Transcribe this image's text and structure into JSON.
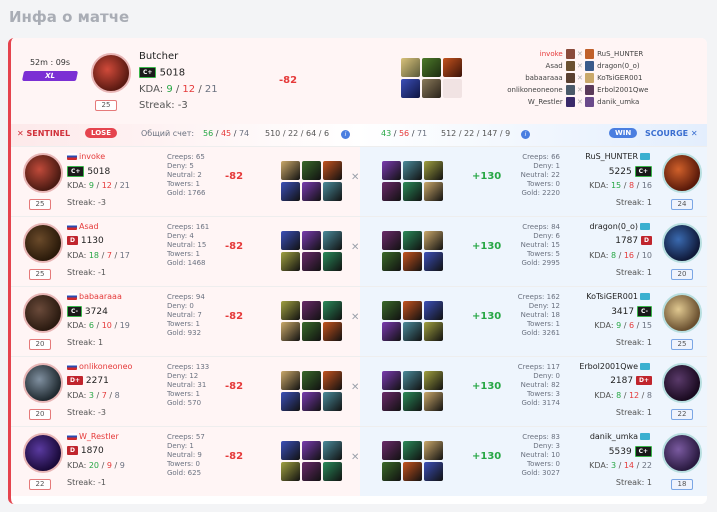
{
  "title": "Инфа о матче",
  "summary": {
    "duration": "52m : 09s",
    "size": "XL",
    "hero_level": "25",
    "name": "Butcher",
    "rank": "C+",
    "rating": "5018",
    "kda_label": "KDA:",
    "kda": [
      "9",
      "12",
      "21"
    ],
    "streak": "Streak: -3",
    "rating_change": "-82",
    "matchups": [
      {
        "left": "invoke",
        "right": "RuS_HUNTER"
      },
      {
        "left": "Asad",
        "right": "dragon(0_o)"
      },
      {
        "left": "babaaraaa",
        "right": "KoTsiGER001"
      },
      {
        "left": "onlikoneoneone",
        "right": "Erbol2001Qwe"
      },
      {
        "left": "W_Restler",
        "right": "danik_umka"
      }
    ]
  },
  "teambar": {
    "sentinel": "SENTINEL",
    "lose": "LOSE",
    "total_label": "Общий счет:",
    "left_kda": [
      "56",
      "45",
      "74"
    ],
    "left_extra": "510 / 22 / 64 / 6",
    "right_kda": [
      "43",
      "56",
      "71"
    ],
    "right_extra": "512 / 22 / 147 / 9",
    "win": "WIN",
    "scourge": "SCOURGE"
  },
  "rows": [
    {
      "l": {
        "name": "invoke",
        "rank": "C+",
        "rank_class": "cplus",
        "rating": "5018",
        "kda": [
          "9",
          "12",
          "21"
        ],
        "streak": "Streak: -3",
        "level": "25",
        "creeps": "Creeps: 65",
        "deny": "Deny: 5",
        "neutral": "Neutral: 2",
        "towers": "Towers: 1",
        "gold": "Gold: 1766",
        "change": "-82"
      },
      "r": {
        "name": "RuS_HUNTER",
        "rank": "C+",
        "rank_class": "cplus",
        "rating": "5225",
        "kda": [
          "15",
          "8",
          "16"
        ],
        "streak": "Streak: 1",
        "level": "24",
        "creeps": "Creeps: 66",
        "deny": "Deny: 1",
        "neutral": "Neutral: 22",
        "towers": "Towers: 0",
        "gold": "Gold: 2220",
        "change": "+130"
      }
    },
    {
      "l": {
        "name": "Asad",
        "rank": "D",
        "rank_class": "dminus",
        "rating": "1130",
        "kda": [
          "18",
          "7",
          "17"
        ],
        "streak": "Streak: -1",
        "level": "25",
        "creeps": "Creeps: 161",
        "deny": "Deny: 4",
        "neutral": "Neutral: 15",
        "towers": "Towers: 1",
        "gold": "Gold: 1468",
        "change": "-82"
      },
      "r": {
        "name": "dragon(0_o)",
        "rank": "D",
        "rank_class": "dminus",
        "rating": "1787",
        "kda": [
          "8",
          "16",
          "10"
        ],
        "streak": "Streak: 1",
        "level": "20",
        "creeps": "Creeps: 84",
        "deny": "Deny: 6",
        "neutral": "Neutral: 15",
        "towers": "Towers: 5",
        "gold": "Gold: 2995",
        "change": "+130"
      }
    },
    {
      "l": {
        "name": "babaaraaa",
        "rank": "C-",
        "rank_class": "cplus",
        "rating": "3724",
        "kda": [
          "6",
          "10",
          "19"
        ],
        "streak": "Streak: 1",
        "level": "20",
        "creeps": "Creeps: 94",
        "deny": "Deny: 0",
        "neutral": "Neutral: 7",
        "towers": "Towers: 1",
        "gold": "Gold: 932",
        "change": "-82"
      },
      "r": {
        "name": "KoTsiGER001",
        "rank": "C-",
        "rank_class": "cplus",
        "rating": "3417",
        "kda": [
          "9",
          "6",
          "15"
        ],
        "streak": "Streak: 1",
        "level": "25",
        "creeps": "Creeps: 162",
        "deny": "Deny: 12",
        "neutral": "Neutral: 18",
        "towers": "Towers: 1",
        "gold": "Gold: 3261",
        "change": "+130"
      }
    },
    {
      "l": {
        "name": "onlikoneoneo",
        "rank": "D+",
        "rank_class": "dplus",
        "rating": "2271",
        "kda": [
          "3",
          "7",
          "8"
        ],
        "streak": "Streak: -3",
        "level": "20",
        "creeps": "Creeps: 133",
        "deny": "Deny: 12",
        "neutral": "Neutral: 31",
        "towers": "Towers: 1",
        "gold": "Gold: 570",
        "change": "-82"
      },
      "r": {
        "name": "Erbol2001Qwe",
        "rank": "D+",
        "rank_class": "dplus",
        "rating": "2187",
        "kda": [
          "8",
          "12",
          "8"
        ],
        "streak": "Streak: 1",
        "level": "22",
        "creeps": "Creeps: 117",
        "deny": "Deny: 0",
        "neutral": "Neutral: 82",
        "towers": "Towers: 3",
        "gold": "Gold: 3174",
        "change": "+130"
      }
    },
    {
      "l": {
        "name": "W_Restler",
        "rank": "D",
        "rank_class": "dminus",
        "rating": "1870",
        "kda": [
          "20",
          "9",
          "9"
        ],
        "streak": "Streak: -1",
        "level": "22",
        "creeps": "Creeps: 57",
        "deny": "Deny: 1",
        "neutral": "Neutral: 9",
        "towers": "Towers: 0",
        "gold": "Gold: 625",
        "change": "-82"
      },
      "r": {
        "name": "danik_umka",
        "rank": "C+",
        "rank_class": "cplus",
        "rating": "5539",
        "kda": [
          "3",
          "14",
          "22"
        ],
        "streak": "Streak: 1",
        "level": "18",
        "creeps": "Creeps: 83",
        "deny": "Deny: 3",
        "neutral": "Neutral: 10",
        "towers": "Towers: 0",
        "gold": "Gold: 3027",
        "change": "+130"
      }
    }
  ]
}
